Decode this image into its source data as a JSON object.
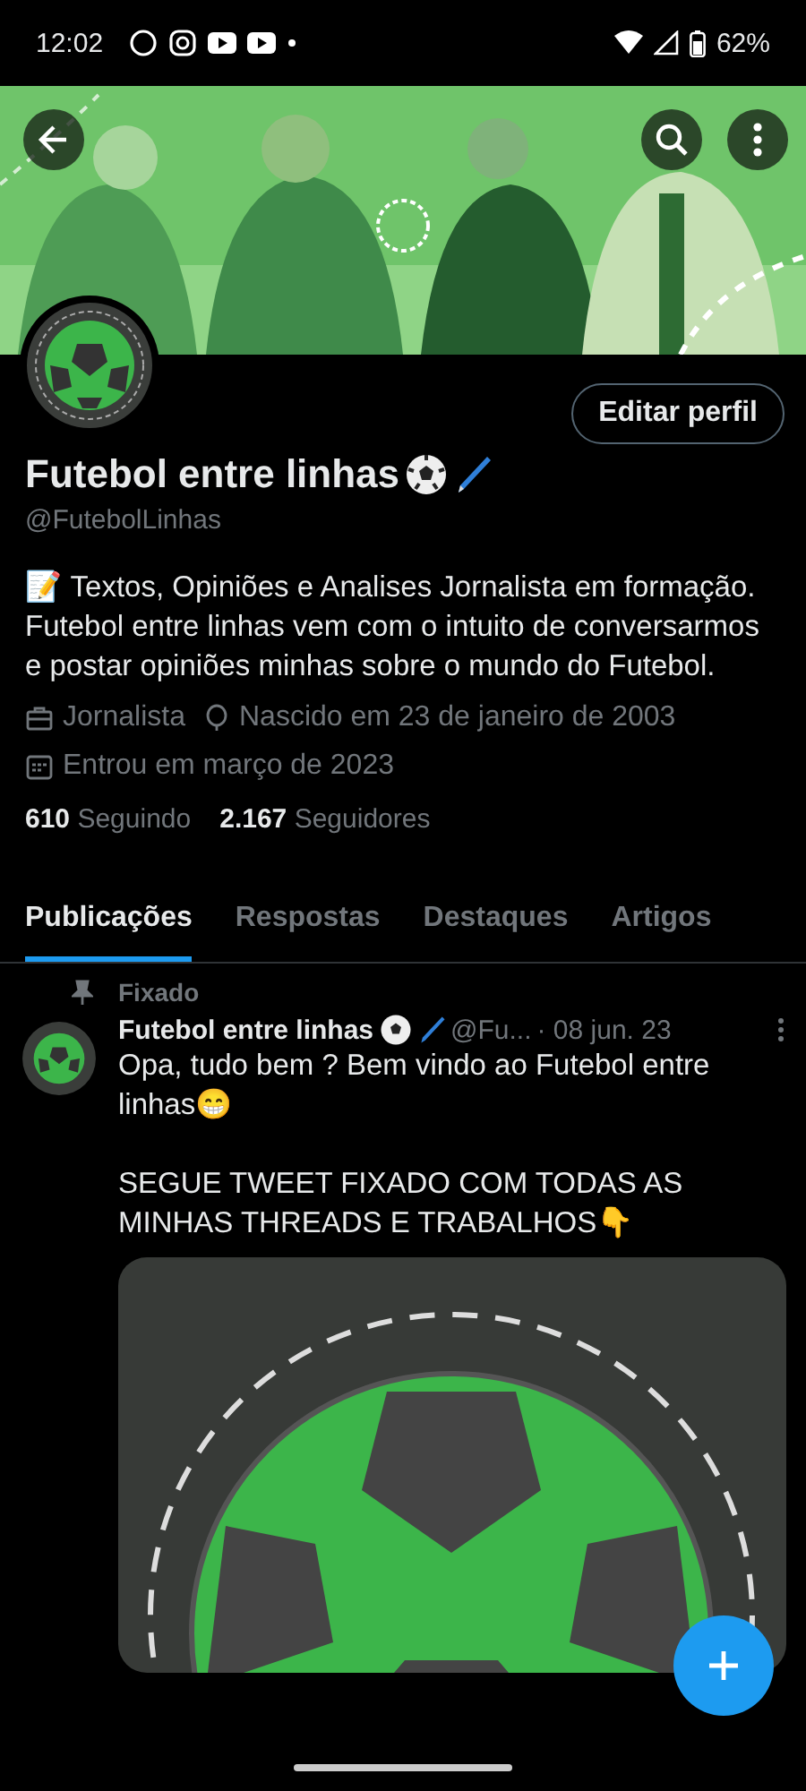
{
  "status_bar": {
    "time": "12:02",
    "battery": "62%"
  },
  "profile": {
    "edit_button": "Editar perfil",
    "name": "Futebol entre linhas",
    "handle": "@FutebolLinhas",
    "bio": "📝 Textos, Opiniões e Analises Jornalista em formação. Futebol entre linhas vem com o intuito de conversarmos e postar opiniões minhas sobre o mundo do Futebol.",
    "profession": "Jornalista",
    "birth": "Nascido em 23 de janeiro de 2003",
    "joined": "Entrou em março de 2023",
    "following_count": "610",
    "following_label": "Seguindo",
    "followers_count": "2.167",
    "followers_label": "Seguidores"
  },
  "tabs": [
    {
      "label": "Publicações",
      "selected": true
    },
    {
      "label": "Respostas",
      "selected": false
    },
    {
      "label": "Destaques",
      "selected": false
    },
    {
      "label": "Artigos",
      "selected": false
    }
  ],
  "post": {
    "pinned_label": "Fixado",
    "author": "Futebol entre linhas",
    "handle": "@Fu...",
    "date": "· 08 jun. 23",
    "text_1": "Opa, tudo bem ? Bem vindo ao Futebol entre linhas😁",
    "text_2": "SEGUE TWEET FIXADO COM TODAS AS MINHAS THREADS E TRABALHOS👇"
  }
}
